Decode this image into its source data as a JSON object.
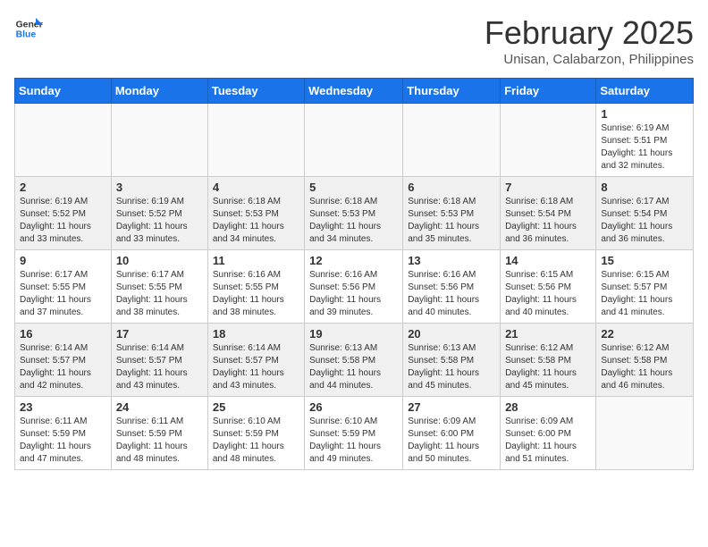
{
  "header": {
    "logo_line1": "General",
    "logo_line2": "Blue",
    "month_year": "February 2025",
    "location": "Unisan, Calabarzon, Philippines"
  },
  "days_of_week": [
    "Sunday",
    "Monday",
    "Tuesday",
    "Wednesday",
    "Thursday",
    "Friday",
    "Saturday"
  ],
  "weeks": [
    [
      {
        "day": "",
        "info": ""
      },
      {
        "day": "",
        "info": ""
      },
      {
        "day": "",
        "info": ""
      },
      {
        "day": "",
        "info": ""
      },
      {
        "day": "",
        "info": ""
      },
      {
        "day": "",
        "info": ""
      },
      {
        "day": "1",
        "info": "Sunrise: 6:19 AM\nSunset: 5:51 PM\nDaylight: 11 hours and 32 minutes."
      }
    ],
    [
      {
        "day": "2",
        "info": "Sunrise: 6:19 AM\nSunset: 5:52 PM\nDaylight: 11 hours and 33 minutes."
      },
      {
        "day": "3",
        "info": "Sunrise: 6:19 AM\nSunset: 5:52 PM\nDaylight: 11 hours and 33 minutes."
      },
      {
        "day": "4",
        "info": "Sunrise: 6:18 AM\nSunset: 5:53 PM\nDaylight: 11 hours and 34 minutes."
      },
      {
        "day": "5",
        "info": "Sunrise: 6:18 AM\nSunset: 5:53 PM\nDaylight: 11 hours and 34 minutes."
      },
      {
        "day": "6",
        "info": "Sunrise: 6:18 AM\nSunset: 5:53 PM\nDaylight: 11 hours and 35 minutes."
      },
      {
        "day": "7",
        "info": "Sunrise: 6:18 AM\nSunset: 5:54 PM\nDaylight: 11 hours and 36 minutes."
      },
      {
        "day": "8",
        "info": "Sunrise: 6:17 AM\nSunset: 5:54 PM\nDaylight: 11 hours and 36 minutes."
      }
    ],
    [
      {
        "day": "9",
        "info": "Sunrise: 6:17 AM\nSunset: 5:55 PM\nDaylight: 11 hours and 37 minutes."
      },
      {
        "day": "10",
        "info": "Sunrise: 6:17 AM\nSunset: 5:55 PM\nDaylight: 11 hours and 38 minutes."
      },
      {
        "day": "11",
        "info": "Sunrise: 6:16 AM\nSunset: 5:55 PM\nDaylight: 11 hours and 38 minutes."
      },
      {
        "day": "12",
        "info": "Sunrise: 6:16 AM\nSunset: 5:56 PM\nDaylight: 11 hours and 39 minutes."
      },
      {
        "day": "13",
        "info": "Sunrise: 6:16 AM\nSunset: 5:56 PM\nDaylight: 11 hours and 40 minutes."
      },
      {
        "day": "14",
        "info": "Sunrise: 6:15 AM\nSunset: 5:56 PM\nDaylight: 11 hours and 40 minutes."
      },
      {
        "day": "15",
        "info": "Sunrise: 6:15 AM\nSunset: 5:57 PM\nDaylight: 11 hours and 41 minutes."
      }
    ],
    [
      {
        "day": "16",
        "info": "Sunrise: 6:14 AM\nSunset: 5:57 PM\nDaylight: 11 hours and 42 minutes."
      },
      {
        "day": "17",
        "info": "Sunrise: 6:14 AM\nSunset: 5:57 PM\nDaylight: 11 hours and 43 minutes."
      },
      {
        "day": "18",
        "info": "Sunrise: 6:14 AM\nSunset: 5:57 PM\nDaylight: 11 hours and 43 minutes."
      },
      {
        "day": "19",
        "info": "Sunrise: 6:13 AM\nSunset: 5:58 PM\nDaylight: 11 hours and 44 minutes."
      },
      {
        "day": "20",
        "info": "Sunrise: 6:13 AM\nSunset: 5:58 PM\nDaylight: 11 hours and 45 minutes."
      },
      {
        "day": "21",
        "info": "Sunrise: 6:12 AM\nSunset: 5:58 PM\nDaylight: 11 hours and 45 minutes."
      },
      {
        "day": "22",
        "info": "Sunrise: 6:12 AM\nSunset: 5:58 PM\nDaylight: 11 hours and 46 minutes."
      }
    ],
    [
      {
        "day": "23",
        "info": "Sunrise: 6:11 AM\nSunset: 5:59 PM\nDaylight: 11 hours and 47 minutes."
      },
      {
        "day": "24",
        "info": "Sunrise: 6:11 AM\nSunset: 5:59 PM\nDaylight: 11 hours and 48 minutes."
      },
      {
        "day": "25",
        "info": "Sunrise: 6:10 AM\nSunset: 5:59 PM\nDaylight: 11 hours and 48 minutes."
      },
      {
        "day": "26",
        "info": "Sunrise: 6:10 AM\nSunset: 5:59 PM\nDaylight: 11 hours and 49 minutes."
      },
      {
        "day": "27",
        "info": "Sunrise: 6:09 AM\nSunset: 6:00 PM\nDaylight: 11 hours and 50 minutes."
      },
      {
        "day": "28",
        "info": "Sunrise: 6:09 AM\nSunset: 6:00 PM\nDaylight: 11 hours and 51 minutes."
      },
      {
        "day": "",
        "info": ""
      }
    ]
  ]
}
